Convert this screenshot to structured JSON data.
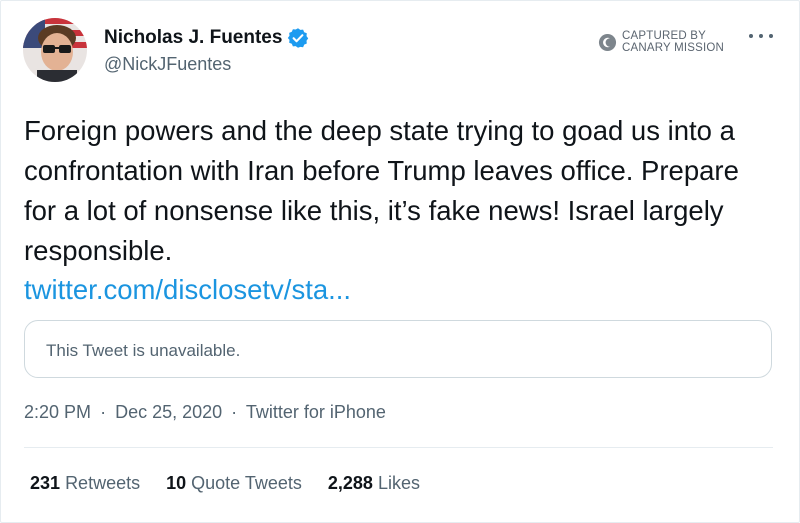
{
  "author": {
    "display_name": "Nicholas J. Fuentes",
    "handle": "@NickJFuentes",
    "verified": true
  },
  "watermark": {
    "line1": "CAPTURED BY",
    "line2": "CANARY MISSION"
  },
  "tweet": {
    "text": "Foreign powers and the deep state trying to goad us into a confrontation with Iran before Trump leaves office. Prepare for a lot of nonsense like this, it’s fake news! Israel largely responsible.",
    "link": "twitter.com/disclosetv/sta...",
    "quoted_status": "This Tweet is unavailable."
  },
  "meta": {
    "time": "2:20 PM",
    "date": "Dec 25, 2020",
    "source": "Twitter for iPhone",
    "separator": "·"
  },
  "stats": {
    "retweets_count": "231",
    "retweets_label": "Retweets",
    "quotes_count": "10",
    "quotes_label": "Quote Tweets",
    "likes_count": "2,288",
    "likes_label": "Likes"
  },
  "colors": {
    "link": "#1b95e0",
    "verified": "#1d9bf0",
    "text": "#0f1419",
    "secondary": "#536471",
    "border": "#e6ecf0"
  }
}
